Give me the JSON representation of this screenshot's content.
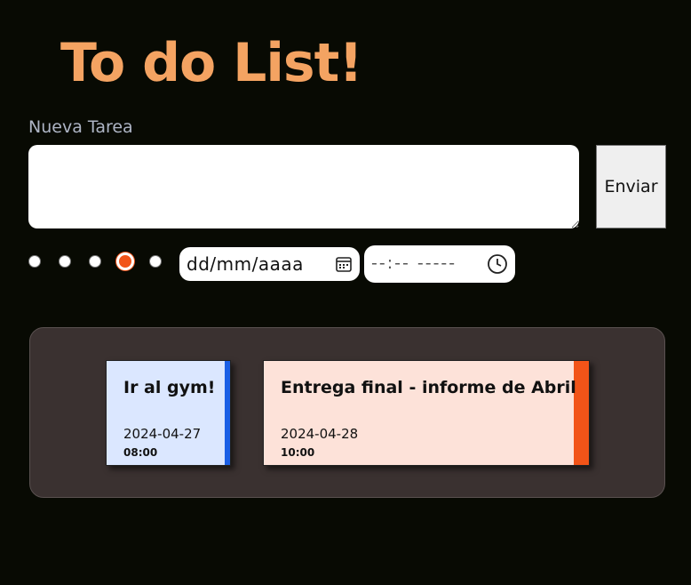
{
  "header": {
    "title": "To do List!"
  },
  "form": {
    "task_label": "Nueva Tarea",
    "task_value": "",
    "send_label": "Enviar",
    "priority_options": 5,
    "selected_priority": 4,
    "date_placeholder": "dd/mm/aaaa",
    "time_placeholder": "--:-- -----"
  },
  "tasks": [
    {
      "title": "Ir al gym!",
      "date": "2024-04-27",
      "time": "08:00",
      "color": "#dbe7ff",
      "accent": "#1a5fe6"
    },
    {
      "title": "Entrega final - informe de Abril",
      "date": "2024-04-28",
      "time": "10:00",
      "color": "#fde2d9",
      "accent": "#f25418"
    }
  ],
  "colors": {
    "background": "#080a03",
    "title": "#f4a362",
    "board": "#3a3130"
  }
}
